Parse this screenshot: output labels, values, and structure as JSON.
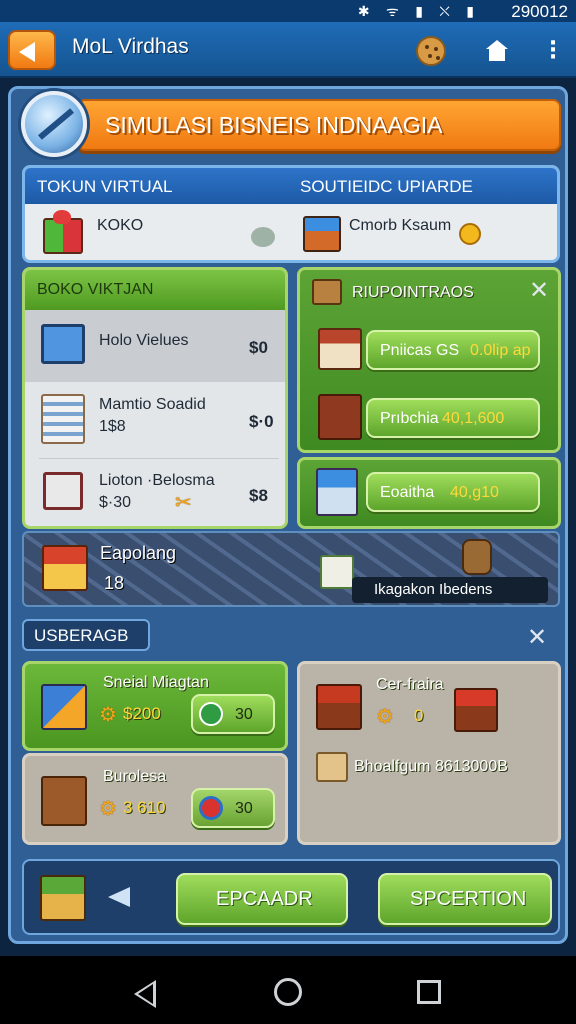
{
  "statusbar": {
    "icons": "✱ ᯤ ▮ ⛌ ▮",
    "time": "290012"
  },
  "appbar": {
    "title": "MoL Virdhas"
  },
  "banner": {
    "title": "SIMULASI BISNEIS INDNAAGIA"
  },
  "top_card": {
    "left_header": "TOKUN VIRTUAL",
    "right_header": "SOUTIEIDC UPIARDE",
    "left_item": "KOKO",
    "right_item": "Cmorb Ksaum"
  },
  "shop_panel": {
    "header": "BOKO VIKTJAN",
    "items": [
      {
        "name": "Holo Vielues",
        "sub": "",
        "price": "$0"
      },
      {
        "name": "Mamtio Soadid",
        "sub": "1$8",
        "price": "$·0"
      },
      {
        "name": "Lioton ·Belosma",
        "sub": "$·30",
        "price": "$8"
      }
    ]
  },
  "upgrades_panel": {
    "header": "RIUPOINTRAOS",
    "buttons": [
      {
        "label": "Pniicas GS",
        "value": "0.0lip ap"
      },
      {
        "label": "Prıbchia",
        "value": "40,1,600"
      }
    ],
    "extra": {
      "label": "Eoaitha",
      "value": "40,g10"
    }
  },
  "map_strip": {
    "title": "Eapolang",
    "count": "18",
    "note": "Ikagakon Ibedens"
  },
  "usage_panel": {
    "header": "USBERAGB",
    "cards": [
      {
        "name": "Sneial Miagtan",
        "cost": "$200",
        "timer": "30"
      },
      {
        "name": "Burolesa",
        "cost": "3 610",
        "timer": "30"
      }
    ],
    "right": {
      "title": "Cer-fraira",
      "cost": "0",
      "line": "Bhoalfgum 8613000B"
    }
  },
  "bottom_bar": {
    "left_button": "EPCAADR",
    "right_button": "SPCERTION"
  },
  "colors": {
    "green": "#5ea62c",
    "orange": "#f07a12",
    "blue": "#1d5aa6"
  }
}
